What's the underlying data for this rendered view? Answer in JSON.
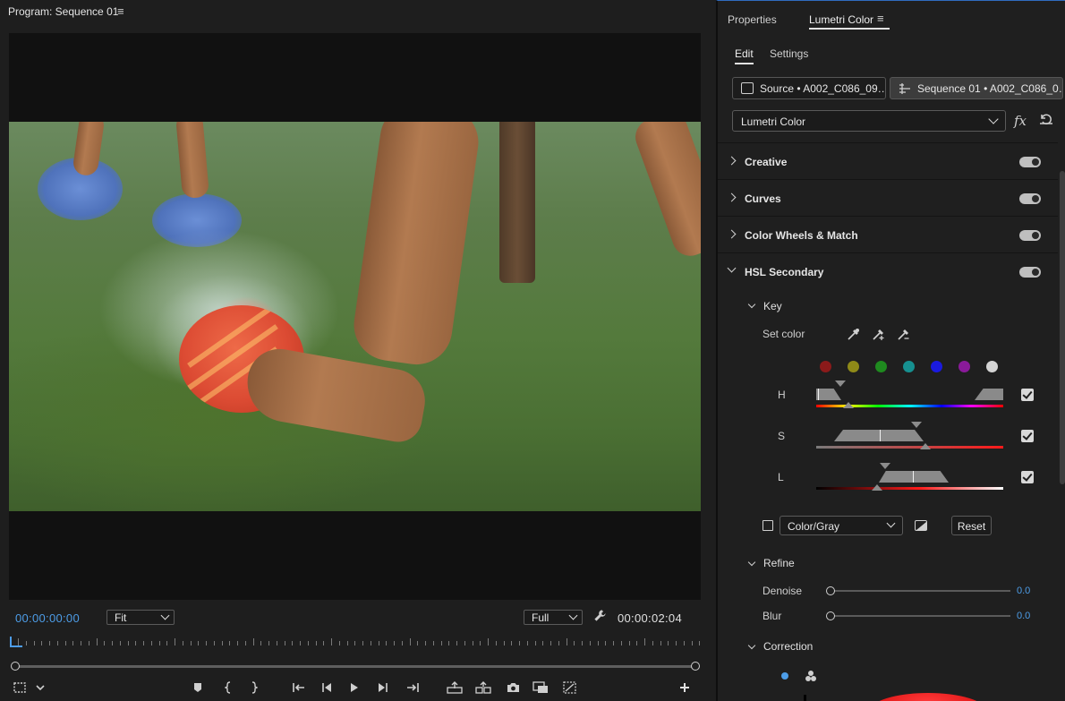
{
  "program": {
    "title": "Program: Sequence 01",
    "menu_glyph": "≡",
    "timecode_current": "00:00:00:00",
    "timecode_duration": "00:00:02:04",
    "zoom_select": "Fit",
    "resolution_select": "Full",
    "accent_color": "#4d9de8"
  },
  "lumetri": {
    "tabs": [
      {
        "label": "Properties"
      },
      {
        "label": "Lumetri Color"
      }
    ],
    "tab_menu_glyph": "≡",
    "subtabs": [
      {
        "label": "Edit"
      },
      {
        "label": "Settings"
      }
    ],
    "source_clip": "Source • A002_C086_09…",
    "sequence_clip": "Sequence 01 • A002_C086_0…",
    "effect_select": "Lumetri Color",
    "fx_label": "fx",
    "sections": [
      {
        "label": "Creative",
        "enabled": true,
        "expanded": false
      },
      {
        "label": "Curves",
        "enabled": true,
        "expanded": false
      },
      {
        "label": "Color Wheels & Match",
        "enabled": true,
        "expanded": false
      },
      {
        "label": "HSL Secondary",
        "enabled": true,
        "expanded": true
      }
    ],
    "hsl": {
      "key_label": "Key",
      "set_color_label": "Set color",
      "swatches": [
        "#8b1a1a",
        "#8f8a18",
        "#1f8a1f",
        "#169090",
        "#1a1ae0",
        "#8a1a9a",
        "#d4d4d4"
      ],
      "channels": [
        {
          "label": "H",
          "checked": true
        },
        {
          "label": "S",
          "checked": true
        },
        {
          "label": "L",
          "checked": true
        }
      ],
      "mask_mode": "Color/Gray",
      "reset_label": "Reset",
      "refine_label": "Refine",
      "denoise_label": "Denoise",
      "denoise_value": "0.0",
      "blur_label": "Blur",
      "blur_value": "0.0",
      "correction_label": "Correction"
    }
  }
}
